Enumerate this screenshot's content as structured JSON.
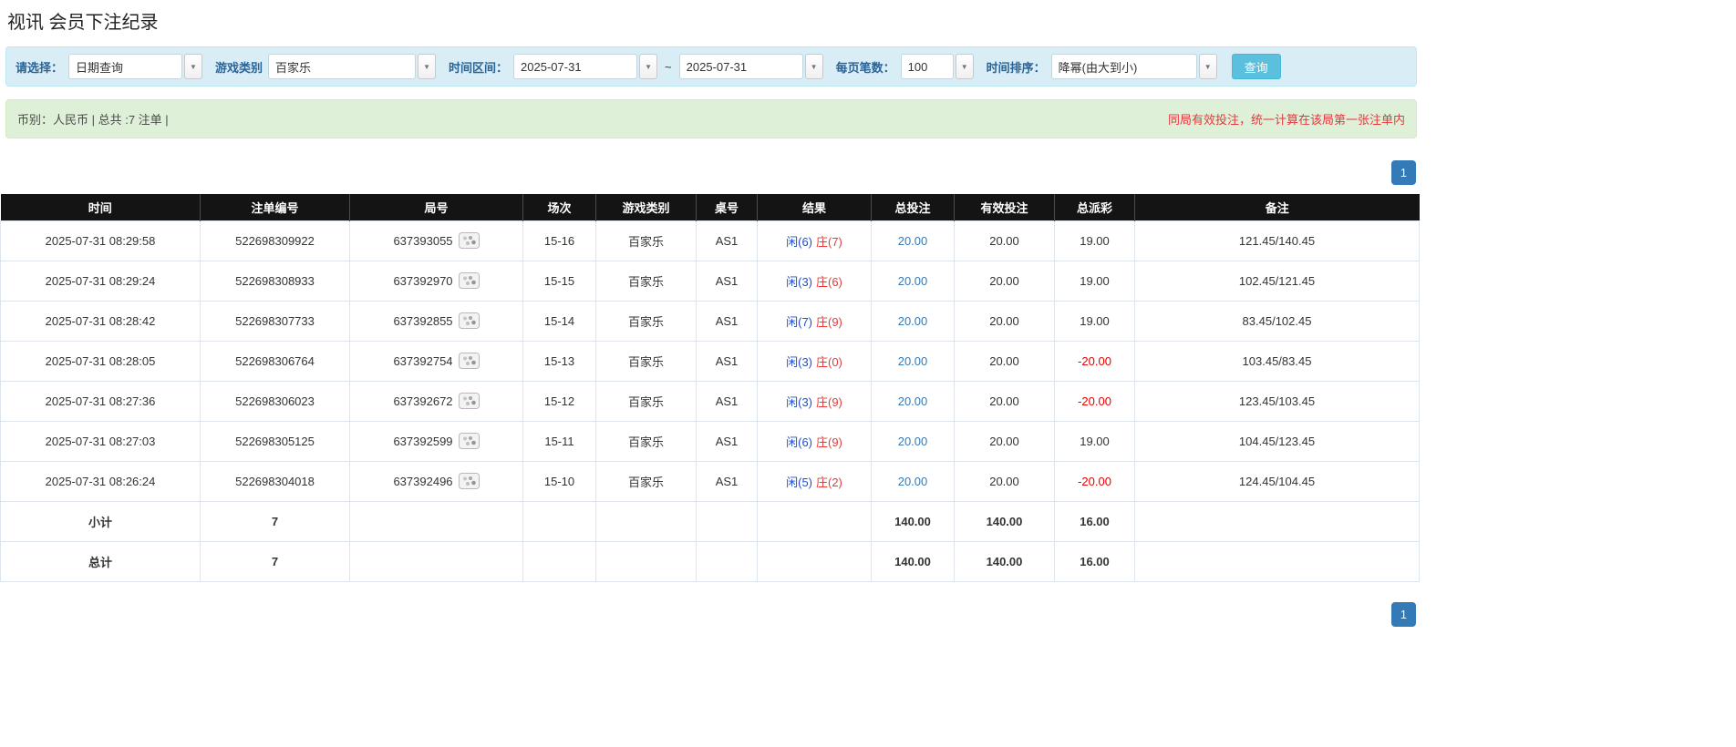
{
  "page": {
    "title": "视讯 会员下注纪录"
  },
  "filters": {
    "select_label": "请选择：",
    "select_value": "日期查询",
    "game_type_label": "游戏类别",
    "game_type_value": "百家乐",
    "time_range_label": "时间区间：",
    "time_from": "2025-07-31",
    "time_to": "2025-07-31",
    "tilde": "~",
    "page_size_label": "每页笔数：",
    "page_size_value": "100",
    "sort_label": "时间排序：",
    "sort_value": "降幂(由大到小)",
    "search_button": "查询",
    "chevron_icon": "▼"
  },
  "summary": {
    "left": "币别：人民币 | 总共 :7 注单 |",
    "right": "同局有效投注，统一计算在该局第一张注单内"
  },
  "pagination": {
    "page": "1"
  },
  "table": {
    "headers": [
      "时间",
      "注单编号",
      "局号",
      "场次",
      "游戏类别",
      "桌号",
      "结果",
      "总投注",
      "有效投注",
      "总派彩",
      "备注"
    ],
    "rows": [
      {
        "time": "2025-07-31 08:29:58",
        "bet_id": "522698309922",
        "round_id": "637393055",
        "session": "15-16",
        "game": "百家乐",
        "table_no": "AS1",
        "result_player": "闲(6)",
        "result_banker": "庄(7)",
        "total_bet": "20.00",
        "valid_bet": "20.00",
        "payout": "19.00",
        "remark": "121.45/140.45"
      },
      {
        "time": "2025-07-31 08:29:24",
        "bet_id": "522698308933",
        "round_id": "637392970",
        "session": "15-15",
        "game": "百家乐",
        "table_no": "AS1",
        "result_player": "闲(3)",
        "result_banker": "庄(6)",
        "total_bet": "20.00",
        "valid_bet": "20.00",
        "payout": "19.00",
        "remark": "102.45/121.45"
      },
      {
        "time": "2025-07-31 08:28:42",
        "bet_id": "522698307733",
        "round_id": "637392855",
        "session": "15-14",
        "game": "百家乐",
        "table_no": "AS1",
        "result_player": "闲(7)",
        "result_banker": "庄(9)",
        "total_bet": "20.00",
        "valid_bet": "20.00",
        "payout": "19.00",
        "remark": "83.45/102.45"
      },
      {
        "time": "2025-07-31 08:28:05",
        "bet_id": "522698306764",
        "round_id": "637392754",
        "session": "15-13",
        "game": "百家乐",
        "table_no": "AS1",
        "result_player": "闲(3)",
        "result_banker": "庄(0)",
        "total_bet": "20.00",
        "valid_bet": "20.00",
        "payout": "-20.00",
        "remark": "103.45/83.45"
      },
      {
        "time": "2025-07-31 08:27:36",
        "bet_id": "522698306023",
        "round_id": "637392672",
        "session": "15-12",
        "game": "百家乐",
        "table_no": "AS1",
        "result_player": "闲(3)",
        "result_banker": "庄(9)",
        "total_bet": "20.00",
        "valid_bet": "20.00",
        "payout": "-20.00",
        "remark": "123.45/103.45"
      },
      {
        "time": "2025-07-31 08:27:03",
        "bet_id": "522698305125",
        "round_id": "637392599",
        "session": "15-11",
        "game": "百家乐",
        "table_no": "AS1",
        "result_player": "闲(6)",
        "result_banker": "庄(9)",
        "total_bet": "20.00",
        "valid_bet": "20.00",
        "payout": "19.00",
        "remark": "104.45/123.45"
      },
      {
        "time": "2025-07-31 08:26:24",
        "bet_id": "522698304018",
        "round_id": "637392496",
        "session": "15-10",
        "game": "百家乐",
        "table_no": "AS1",
        "result_player": "闲(5)",
        "result_banker": "庄(2)",
        "total_bet": "20.00",
        "valid_bet": "20.00",
        "payout": "-20.00",
        "remark": "124.45/104.45"
      }
    ],
    "subtotal": {
      "label": "小计",
      "count": "7",
      "total_bet": "140.00",
      "valid_bet": "140.00",
      "payout": "16.00"
    },
    "total": {
      "label": "总计",
      "count": "7",
      "total_bet": "140.00",
      "valid_bet": "140.00",
      "payout": "16.00"
    }
  },
  "colors": {
    "accent_blue": "#337ab7",
    "filter_bg": "#d9edf7",
    "filter_label_blue": "#2a6496",
    "summary_bg": "#dff0d8",
    "notice_red": "#e4393c",
    "table_header_bg": "#141414",
    "summary_row_bg": "#9d9d9d",
    "player_blue": "#1e4fd8",
    "banker_red": "#e43b3b",
    "negative_red": "#e60000",
    "search_button_bg": "#5bc0de"
  }
}
